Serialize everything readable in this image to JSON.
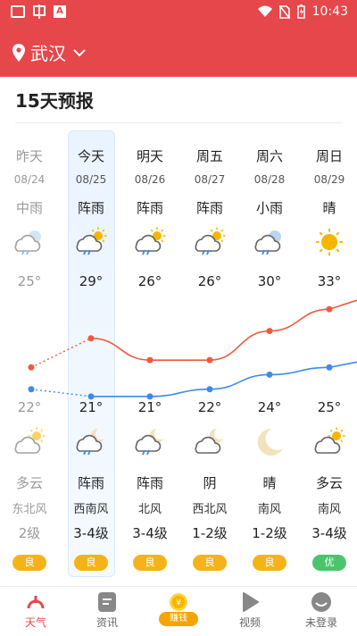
{
  "status": {
    "time": "10:43"
  },
  "header": {
    "city": "武汉"
  },
  "section": {
    "title": "15天预报"
  },
  "days": [
    {
      "day": "昨天",
      "date": "08/24",
      "weather": "中雨",
      "high": "25°",
      "low": "22°",
      "night_weather": "多云",
      "wind": "东北风",
      "level": "2级",
      "aqi": "良",
      "aqi_color": "#f5b319",
      "icon": "rain-cloud-icon",
      "night_icon": "partly-cloudy-icon",
      "past": true
    },
    {
      "day": "今天",
      "date": "08/25",
      "weather": "阵雨",
      "high": "29°",
      "low": "21°",
      "night_weather": "阵雨",
      "wind": "西南风",
      "level": "3-4级",
      "aqi": "良",
      "aqi_color": "#f5b319",
      "icon": "shower-sun-icon",
      "night_icon": "shower-moon-icon",
      "past": false
    },
    {
      "day": "明天",
      "date": "08/26",
      "weather": "阵雨",
      "high": "26°",
      "low": "21°",
      "night_weather": "阵雨",
      "wind": "北风",
      "level": "3-4级",
      "aqi": "良",
      "aqi_color": "#f5b319",
      "icon": "shower-sun-icon",
      "night_icon": "shower-moon-icon",
      "past": false
    },
    {
      "day": "周五",
      "date": "08/27",
      "weather": "阵雨",
      "high": "26°",
      "low": "22°",
      "night_weather": "阴",
      "wind": "西北风",
      "level": "1-2级",
      "aqi": "良",
      "aqi_color": "#f5b319",
      "icon": "shower-sun-icon",
      "night_icon": "cloudy-moon-icon",
      "past": false
    },
    {
      "day": "周六",
      "date": "08/28",
      "weather": "小雨",
      "high": "30°",
      "low": "24°",
      "night_weather": "晴",
      "wind": "南风",
      "level": "1-2级",
      "aqi": "良",
      "aqi_color": "#f5b319",
      "icon": "rain-cloud-icon",
      "night_icon": "moon-icon",
      "past": false
    },
    {
      "day": "周日",
      "date": "08/29",
      "weather": "晴",
      "high": "33°",
      "low": "25°",
      "night_weather": "多云",
      "wind": "南风",
      "level": "3-4级",
      "aqi": "优",
      "aqi_color": "#4cc46c",
      "icon": "sun-icon",
      "night_icon": "partly-cloudy-icon",
      "past": false
    }
  ],
  "chart_data": {
    "type": "line",
    "categories": [
      "08/24",
      "08/25",
      "08/26",
      "08/27",
      "08/28",
      "08/29"
    ],
    "series": [
      {
        "values": [
          25,
          29,
          26,
          26,
          30,
          33
        ],
        "color": "#f05a3c"
      },
      {
        "values": [
          22,
          21,
          21,
          22,
          24,
          25
        ],
        "color": "#3d8be8"
      }
    ]
  },
  "tabs": [
    {
      "label": "天气",
      "icon": "weather-icon",
      "active": true
    },
    {
      "label": "资讯",
      "icon": "news-icon",
      "active": false
    },
    {
      "label": "赚钱",
      "icon": "coin-icon",
      "active": false
    },
    {
      "label": "视频",
      "icon": "video-play-icon",
      "active": false
    },
    {
      "label": "未登录",
      "icon": "user-icon",
      "active": false
    }
  ]
}
